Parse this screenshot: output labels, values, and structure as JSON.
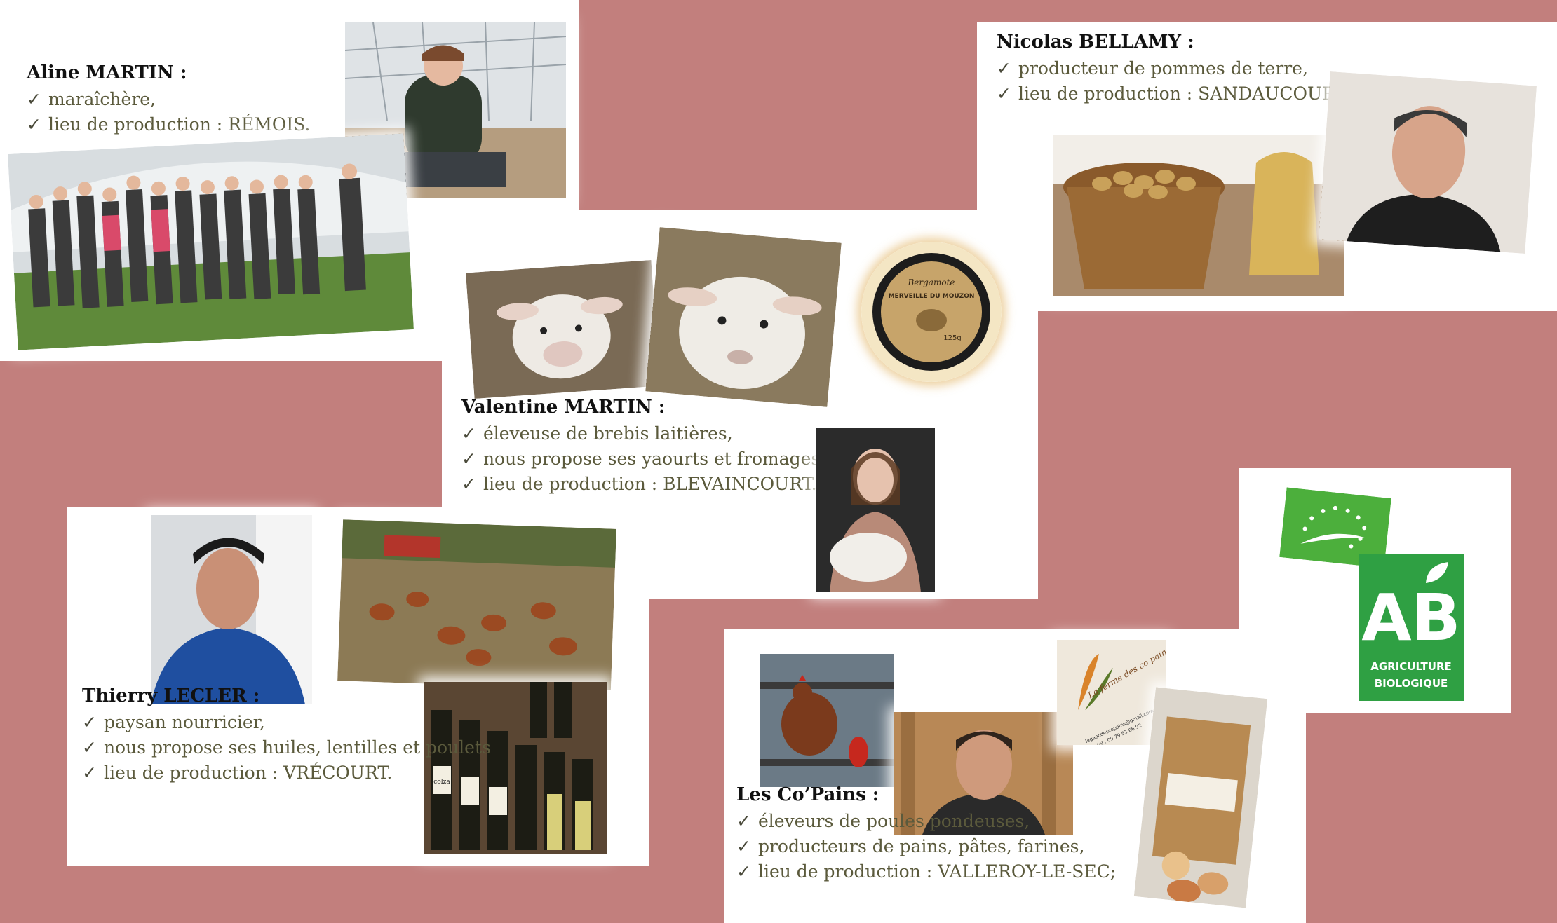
{
  "producers": {
    "aline": {
      "name": "Aline MARTIN :",
      "lines": [
        "maraîchère,",
        "lieu de production : RÉMOIS."
      ]
    },
    "nicolas": {
      "name": "Nicolas BELLAMY :",
      "lines": [
        "producteur de pommes de terre,",
        "lieu de production : SANDAUCOURT."
      ]
    },
    "valentine": {
      "name": "Valentine MARTIN :",
      "lines": [
        "éleveuse de brebis laitières,",
        "nous propose ses yaourts et fromages,",
        "lieu de production : BLEVAINCOURT."
      ]
    },
    "thierry": {
      "name": "Thierry LECLER :",
      "lines": [
        "paysan nourricier,",
        "nous propose ses huiles, lentilles et poulets",
        "lieu de production : VRÉCOURT."
      ]
    },
    "copains": {
      "name": "Les Co’Pains :",
      "lines": [
        "éleveurs de poules pondeuses,",
        "producteurs de pains, pâtes, farines,",
        "lieu de production : VALLEROY-LE-SEC;"
      ]
    }
  },
  "labels": {
    "check": "✓",
    "jar_line1": "Bergamote",
    "jar_line2": "MERVEILLE DU MOUZON",
    "jar_line3": "125g",
    "logo_ab": "AB",
    "logo_line1": "AGRICULTURE",
    "logo_line2": "BIOLOGIQUE",
    "copain_logo_text": "La ferme des co pains",
    "copain_email": "legaecdescopains@gmail.com",
    "copain_tel": "tel : 09 79 53 66 92",
    "bottle_label": "colza"
  },
  "colors": {
    "background": "#c27f7d",
    "ab_green": "#2fa043",
    "text_olive": "#5b5a3c"
  }
}
